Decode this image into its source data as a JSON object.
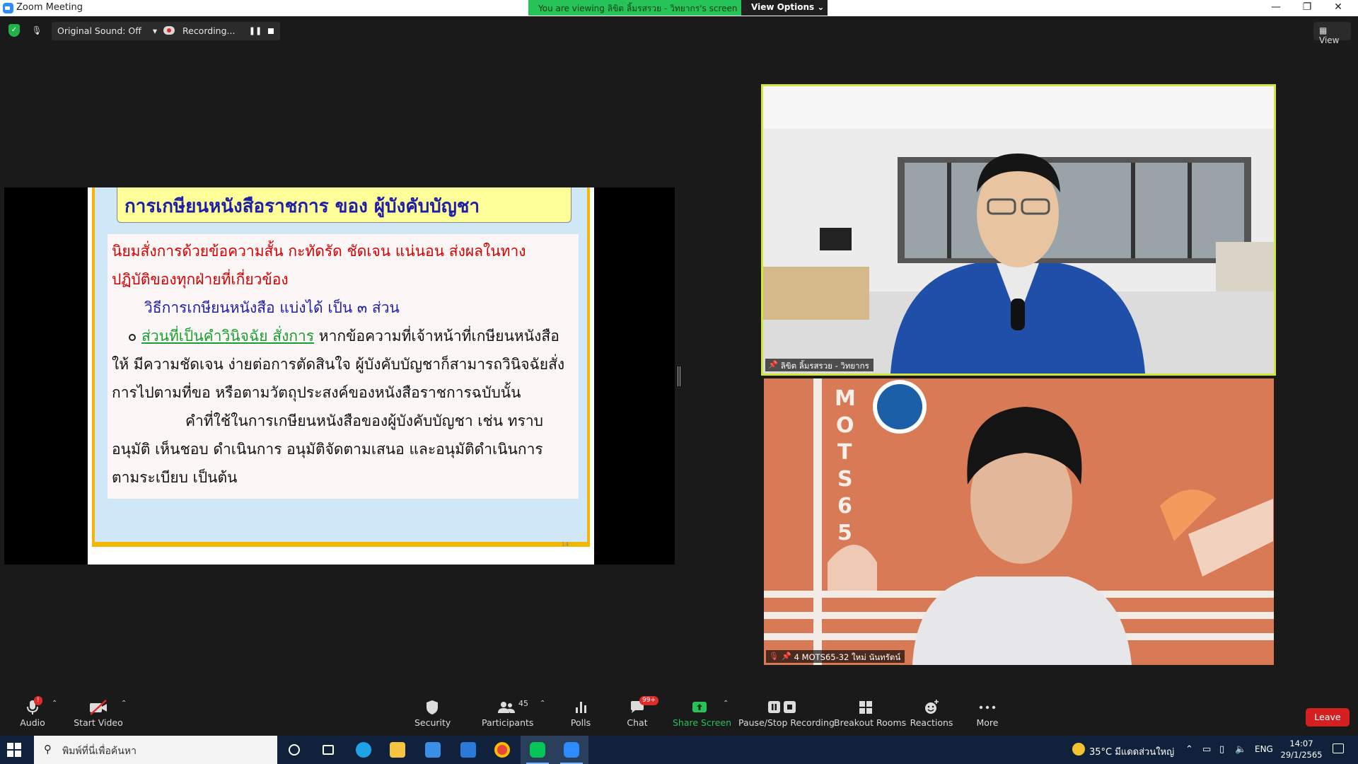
{
  "window": {
    "title": "Zoom Meeting",
    "viewing_banner": "You are viewing ลิขิต ลิ้มรสรวย - วิทยากร's screen",
    "view_options": "View Options ⌄"
  },
  "window_controls": {
    "minimize": "—",
    "restore": "❐",
    "close": "✕"
  },
  "topbar": {
    "original_sound": "Original Sound: Off",
    "original_sound_caret": "▾",
    "recording_label": "Recording...",
    "pause_glyph": "❚❚",
    "view_label": "View"
  },
  "slide": {
    "title": "การเกษียนหนังสือราชการ ของ ผู้บังคับบัญชา",
    "line1": "นิยมสั่งการด้วยข้อความสั้น กะทัดรัด ชัดเจน แน่นอน ส่งผลในทาง",
    "line2": "ปฏิบัติของทุกฝ่ายที่เกี่ยวข้อง",
    "line3": "วิธีการเกษียนหนังสือ แบ่งได้ เป็น ๓ ส่วน",
    "line4_green": "ส่วนที่เป็นคำวินิจฉัย สั่งการ",
    "line4_rest": " หากข้อความที่เจ้าหน้าที่เกษียนหนังสือ",
    "line5": "ให้ มีความชัดเจน ง่ายต่อการตัดสินใจ ผู้บังคับบัญชาก็สามารถวินิจฉัยสั่ง",
    "line6": "การไปตามที่ขอ หรือตามวัตถุประสงค์ของหนังสือราชการฉบับนั้น",
    "line7": "คำที่ใช้ในการเกษียนหนังสือของผู้บังคับบัญชา เช่น ทราบ",
    "line8": "อนุมัติ เห็นชอบ ดำเนินการ อนุมัติจัดตามเสนอ  และอนุมัติดำเนินการ",
    "line9": "ตามระเบียบ  เป็นต้น",
    "page_number": "14"
  },
  "participants": [
    {
      "name": "ลิขิต ลิ้มรสรวย - วิทยากร",
      "pinned": true,
      "muted": false
    },
    {
      "name": "4 MOTS65-32 ใหม่ นันทรัตน์",
      "pinned": true,
      "muted": true,
      "background_text": "MOTS65"
    }
  ],
  "controls": {
    "audio": "Audio",
    "audio_badge": "!",
    "start_video": "Start Video",
    "security": "Security",
    "participants": "Participants",
    "participants_count": "45",
    "polls": "Polls",
    "chat": "Chat",
    "chat_badge": "99+",
    "share_screen": "Share Screen",
    "pause_stop_recording": "Pause/Stop Recording",
    "breakout_rooms": "Breakout Rooms",
    "reactions": "Reactions",
    "more": "More",
    "leave": "Leave",
    "caret": "⌃"
  },
  "taskbar": {
    "search_placeholder": "พิมพ์ที่นี่เพื่อค้นหา",
    "weather": "35°C  มีแดดส่วนใหญ่",
    "language": "ENG",
    "time": "14:07",
    "date": "29/1/2565"
  },
  "colors": {
    "active_speaker_border": "#d2e63c",
    "share_green": "#26c359",
    "leave_red": "#d42020",
    "slide_title_blue": "#1e1ea8",
    "slide_red": "#d40000",
    "slide_green": "#16a030"
  }
}
